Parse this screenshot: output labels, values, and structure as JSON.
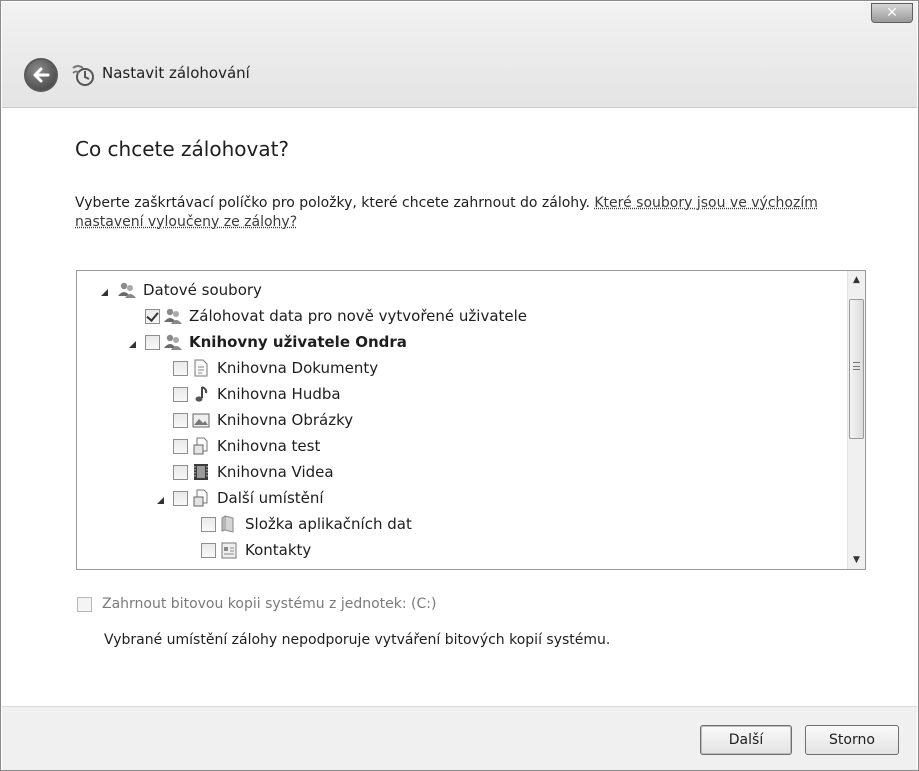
{
  "window": {
    "title": "Nastavit zálohování",
    "close_label": "✕"
  },
  "page": {
    "heading": "Co chcete zálohovat?",
    "instruction": "Vyberte zaškrtávací políčko pro položky, které chcete zahrnout do zálohy.",
    "instruction_link": "Které soubory jsou ve výchozím nastavení vyloučeny ze zálohy?"
  },
  "tree": {
    "items": [
      {
        "label": "Datové soubory",
        "level": 0,
        "expander": true,
        "checkbox": false,
        "checked": false,
        "icon": "users-icon",
        "bold": false
      },
      {
        "label": "Zálohovat data pro nově vytvořené uživatele",
        "level": 1,
        "expander": false,
        "checkbox": true,
        "checked": true,
        "icon": "users-icon",
        "bold": false
      },
      {
        "label": "Knihovny uživatele Ondra",
        "level": 1,
        "expander": true,
        "checkbox": true,
        "checked": false,
        "icon": "users-icon",
        "bold": true
      },
      {
        "label": "Knihovna Dokumenty",
        "level": 2,
        "expander": false,
        "checkbox": true,
        "checked": false,
        "icon": "document-icon",
        "bold": false
      },
      {
        "label": "Knihovna Hudba",
        "level": 2,
        "expander": false,
        "checkbox": true,
        "checked": false,
        "icon": "music-icon",
        "bold": false
      },
      {
        "label": "Knihovna Obrázky",
        "level": 2,
        "expander": false,
        "checkbox": true,
        "checked": false,
        "icon": "picture-icon",
        "bold": false
      },
      {
        "label": "Knihovna test",
        "level": 2,
        "expander": false,
        "checkbox": true,
        "checked": false,
        "icon": "library-icon",
        "bold": false
      },
      {
        "label": "Knihovna Videa",
        "level": 2,
        "expander": false,
        "checkbox": true,
        "checked": false,
        "icon": "video-icon",
        "bold": false
      },
      {
        "label": "Další umístění",
        "level": 2,
        "expander": true,
        "checkbox": true,
        "checked": false,
        "icon": "library-icon",
        "bold": false
      },
      {
        "label": "Složka aplikačních dat",
        "level": 3,
        "expander": false,
        "checkbox": true,
        "checked": false,
        "icon": "folder-icon",
        "bold": false
      },
      {
        "label": "Kontakty",
        "level": 3,
        "expander": false,
        "checkbox": true,
        "checked": false,
        "icon": "contacts-icon",
        "bold": false
      }
    ]
  },
  "system_image": {
    "label": "Zahrnout bitovou kopii systému z jednotek: (C:)",
    "checked": false,
    "enabled": false,
    "note": "Vybrané umístění zálohy nepodporuje vytváření bitových kopií systému."
  },
  "buttons": {
    "next": "Další",
    "cancel": "Storno"
  }
}
